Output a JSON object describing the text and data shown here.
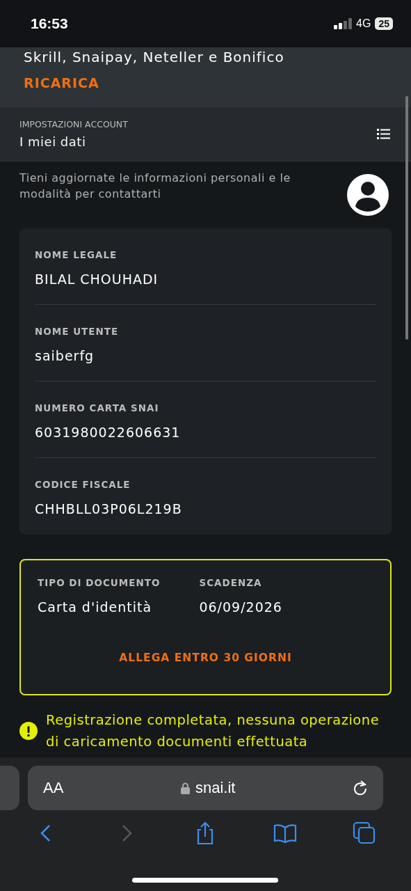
{
  "status_bar": {
    "time": "16:53",
    "network": "4G",
    "battery": "25"
  },
  "top_panel": {
    "methods_text": "Skrill, Snaipay, Neteller e Bonifico",
    "action": "RICARICA"
  },
  "header": {
    "section": "IMPOSTAZIONI ACCOUNT",
    "title": "I miei dati"
  },
  "description": "Tieni aggiornate le informazioni personali e le modalità per contattarti",
  "fields": [
    {
      "label": "NOME LEGALE",
      "value": "BILAL CHOUHADI"
    },
    {
      "label": "NOME UTENTE",
      "value": "saiberfg"
    },
    {
      "label": "NUMERO CARTA SNAI",
      "value": "6031980022606631"
    },
    {
      "label": "CODICE FISCALE",
      "value": "CHHBLL03P06L219B"
    }
  ],
  "document": {
    "columns": [
      {
        "label": "TIPO DI DOCUMENTO",
        "value": "Carta d'identità"
      },
      {
        "label": "SCADENZA",
        "value": "06/09/2026"
      }
    ],
    "action": "ALLEGA ENTRO 30 GIORNI"
  },
  "warning": "Registrazione completata, nessuna operazione di caricamento documenti effettuata",
  "browser": {
    "text_size": "AA",
    "url": "snai.it"
  }
}
